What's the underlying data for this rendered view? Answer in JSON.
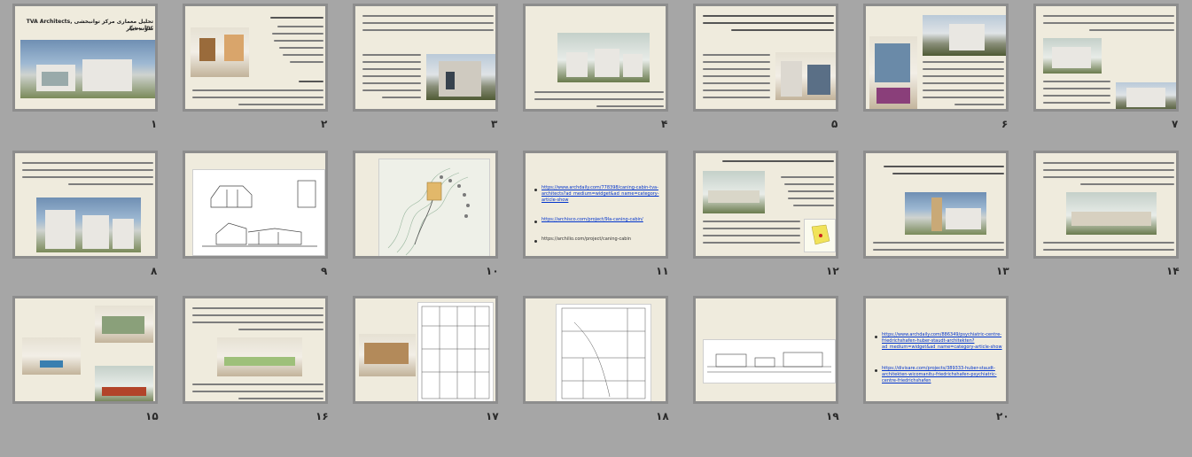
{
  "slides": [
    {
      "number": "۱",
      "title": "تحلیل معماری مرکز توانبخشی TVA Architects, Inc. پیتر،",
      "subtitle": "نمونه دیگر"
    },
    {
      "number": "۲"
    },
    {
      "number": "۳"
    },
    {
      "number": "۴"
    },
    {
      "number": "۵"
    },
    {
      "number": "۶"
    },
    {
      "number": "۷"
    },
    {
      "number": "۸"
    },
    {
      "number": "۹"
    },
    {
      "number": "۱۰"
    },
    {
      "number": "۱۱",
      "links": [
        "https://www.archdaily.com/778398/caning-cabin-tva-architects?ad_medium=widget&ad_name=category-article-show",
        "https://archisco.com/project/9la-caning-cabin/",
        "https://archilio.com/project/caning-cabin"
      ]
    },
    {
      "number": "۱۲"
    },
    {
      "number": "۱۳"
    },
    {
      "number": "۱۴"
    },
    {
      "number": "۱۵"
    },
    {
      "number": "۱۶"
    },
    {
      "number": "۱۷"
    },
    {
      "number": "۱۸"
    },
    {
      "number": "۱۹"
    },
    {
      "number": "۲۰",
      "links": [
        "https://www.archdaily.com/886349/psychiatric-centre-friedrichshafen-huber-staudt-architekten?ad_medium=widget&ad_name=category-article-show",
        "https://divisare.com/projects/389333-huber-staudt-architekten-wicomanitu-friedrichshafen-psychiatric-centre-friedrichshafen"
      ]
    }
  ]
}
